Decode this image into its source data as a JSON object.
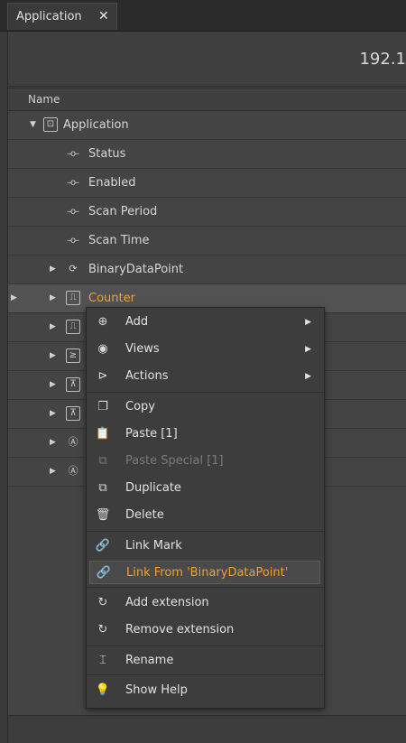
{
  "tab": {
    "title": "Application",
    "close": "✕"
  },
  "header": {
    "ip": "192.1"
  },
  "grid": {
    "column_name": "Name"
  },
  "tree": {
    "root": "Application",
    "status": "Status",
    "enabled": "Enabled",
    "scan_period": "Scan Period",
    "scan_time": "Scan Time",
    "binary": "BinaryDataPoint",
    "counter": "Counter"
  },
  "menu": {
    "add": "Add",
    "views": "Views",
    "actions": "Actions",
    "copy": "Copy",
    "paste": "Paste [1]",
    "paste_special": "Paste Special [1]",
    "duplicate": "Duplicate",
    "delete": "Delete",
    "link_mark": "Link Mark",
    "link_from": "Link From 'BinaryDataPoint'",
    "add_extension": "Add extension",
    "remove_extension": "Remove extension",
    "rename": "Rename",
    "show_help": "Show Help"
  },
  "colors": {
    "accent": "#f0a030",
    "background": "#3a3a3a",
    "menu": "#3d3d3d"
  }
}
